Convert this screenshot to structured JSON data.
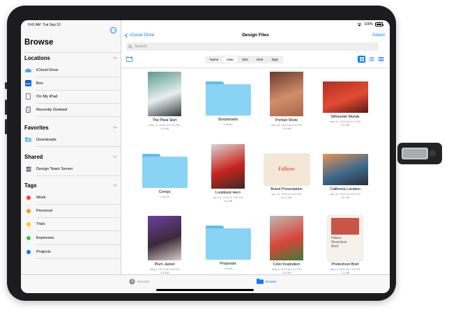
{
  "status": {
    "time": "9:41 AM",
    "date": "Tue Sep 10",
    "battery": "100%"
  },
  "sidebar": {
    "title": "Browse",
    "sections": {
      "locations": {
        "title": "Locations",
        "items": [
          {
            "label": "iCloud Drive",
            "icon": "icloud-icon"
          },
          {
            "label": "Box",
            "icon": "box-icon"
          },
          {
            "label": "On My iPad",
            "icon": "ipad-icon"
          },
          {
            "label": "Recently Deleted",
            "icon": "trash-icon"
          }
        ]
      },
      "favorites": {
        "title": "Favorites",
        "items": [
          {
            "label": "Downloads",
            "icon": "downloads-folder-icon"
          }
        ]
      },
      "shared": {
        "title": "Shared",
        "items": [
          {
            "label": "Design Team Server",
            "icon": "server-icon"
          }
        ]
      },
      "tags": {
        "title": "Tags",
        "items": [
          {
            "label": "Work",
            "color": "#ff3b30"
          },
          {
            "label": "Personal",
            "color": "#ff9500"
          },
          {
            "label": "Trips",
            "color": "#ffcc00"
          },
          {
            "label": "Expenses",
            "color": "#34c759"
          },
          {
            "label": "Projects",
            "color": "#0a7aff"
          }
        ]
      }
    }
  },
  "nav": {
    "back": "iCloud Drive",
    "title": "Design Files",
    "select": "Select"
  },
  "search": {
    "placeholder": "Search"
  },
  "sort": {
    "options": [
      "Name",
      "Date",
      "Size",
      "Kind",
      "Tags"
    ],
    "active": "Date"
  },
  "files": [
    {
      "name": "The Pleat Skirt",
      "date": "Mar 11, 2019 at 2:28 PM",
      "size": "2.8 MB",
      "kind": "photo",
      "colors": [
        "#5c9a8c",
        "#e7eef0",
        "#2f3a3a"
      ]
    },
    {
      "name": "Storyboards",
      "date": "",
      "size": "6 items",
      "kind": "folder"
    },
    {
      "name": "Portrait Shots",
      "date": "Mar 28, 2019 at 5:29 PM",
      "size": "3.5 MB",
      "kind": "photo",
      "colors": [
        "#6b3a2c",
        "#d08e6a",
        "#a8664a"
      ]
    },
    {
      "name": "Silhouette Moods",
      "date": "Mar 29, 2019 at 5:17 PM",
      "size": "3.4 MB",
      "kind": "photo",
      "colors": [
        "#b03022",
        "#e24b33",
        "#5a1912"
      ]
    },
    {
      "name": "Comps",
      "date": "",
      "size": "4 items",
      "kind": "folder"
    },
    {
      "name": "Lookbook Hero",
      "date": "Apr 19, 2019 at 7:50 PM",
      "size": "3.6 MB",
      "kind": "photo",
      "colors": [
        "#d8d6d2",
        "#c9231e",
        "#3b2a22"
      ]
    },
    {
      "name": "Brand Presentation",
      "date": "Apr 20, 2019 at 3:52 PM",
      "size": "54.1 MB",
      "kind": "doc",
      "text": "Falkow",
      "colors": [
        "#f3e8d6",
        "#d2342c"
      ]
    },
    {
      "name": "California Location",
      "date": "Apr 26, 2019 at 5:32 PM",
      "size": "3.5 MB",
      "kind": "photo",
      "colors": [
        "#e89352",
        "#3e6a8c",
        "#2a2f3a"
      ]
    },
    {
      "name": "Plum Jacket",
      "date": "May 6, 2019 at 8:28 PM",
      "size": "3.6 MB",
      "kind": "photo",
      "colors": [
        "#6b3fa0",
        "#3b2a3a",
        "#d9cfc4"
      ]
    },
    {
      "name": "Proposals",
      "date": "",
      "size": "3 items",
      "kind": "folder"
    },
    {
      "name": "Color Inspiration",
      "date": "May 8, 2019 at 5:14 PM",
      "size": "3.6 MB",
      "kind": "photo",
      "colors": [
        "#bcb9b2",
        "#d9463a",
        "#3e7a3a"
      ]
    },
    {
      "name": "Photoshoot Brief",
      "date": "May 9, 2019 at 7:43 PM",
      "size": "1.2 MB",
      "kind": "doc",
      "text": "Falkow\nPhotoshoot\nBrief",
      "colors": [
        "#f6f1ea",
        "#c0392b"
      ]
    }
  ],
  "tabbar": {
    "recents": "Recents",
    "browse": "Browse"
  }
}
